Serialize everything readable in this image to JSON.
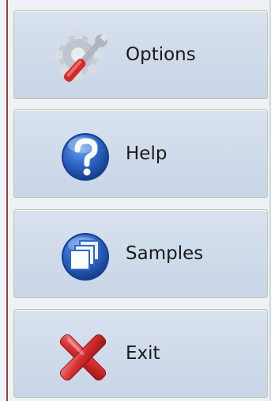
{
  "menu": {
    "items": [
      {
        "label": "Options",
        "icon": "options-gear-wrench-icon"
      },
      {
        "label": "Help",
        "icon": "help-question-icon"
      },
      {
        "label": "Samples",
        "icon": "samples-windows-icon"
      },
      {
        "label": "Exit",
        "icon": "exit-x-icon"
      }
    ]
  },
  "colors": {
    "panel_background": "#eef1f5",
    "button_background": "#cfdaea",
    "button_border": "#b9c9a4",
    "left_rule": "#9a3a3a",
    "help_blue": "#2f67c8",
    "exit_red": "#c62828"
  }
}
